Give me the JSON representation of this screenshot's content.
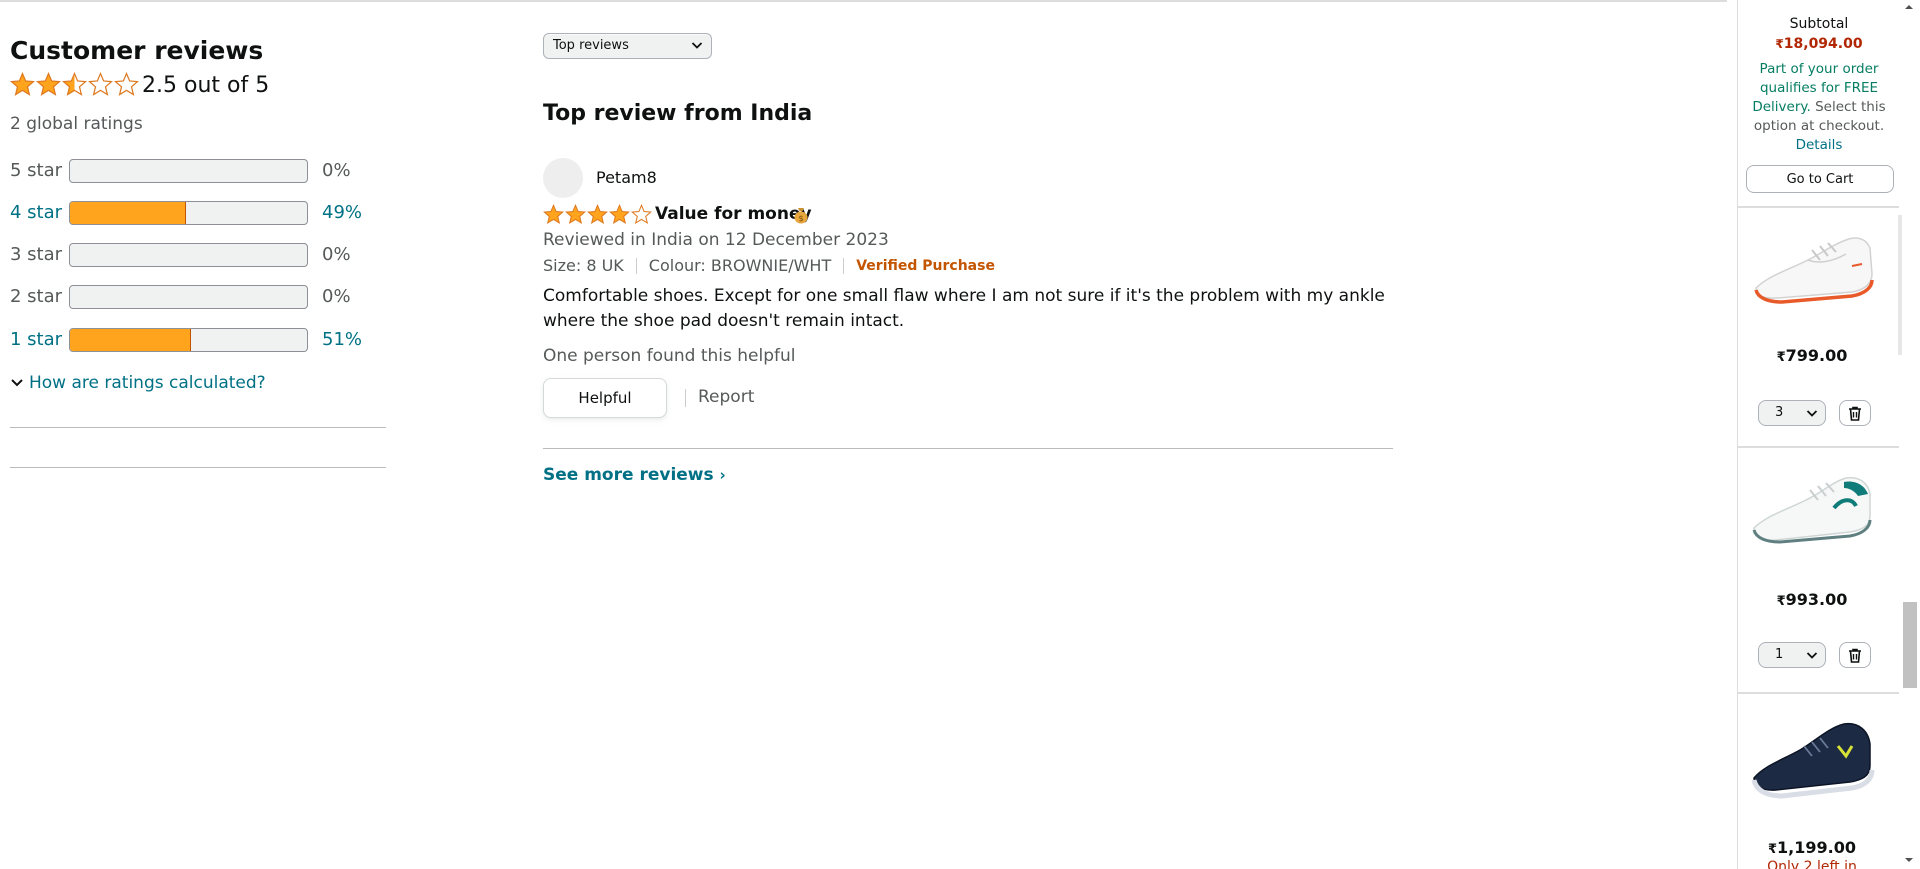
{
  "reviews_summary": {
    "heading": "Customer reviews",
    "average_rating": 2.5,
    "average_text": "2.5 out of 5",
    "global_ratings": "2 global ratings",
    "histogram": [
      {
        "label": "5 star",
        "percent_text": "0%",
        "percent": 0,
        "linked": false
      },
      {
        "label": "4 star",
        "percent_text": "49%",
        "percent": 49,
        "linked": true
      },
      {
        "label": "3 star",
        "percent_text": "0%",
        "percent": 0,
        "linked": false
      },
      {
        "label": "2 star",
        "percent_text": "0%",
        "percent": 0,
        "linked": false
      },
      {
        "label": "1 star",
        "percent_text": "51%",
        "percent": 51,
        "linked": true
      }
    ],
    "how_calculated": "How are ratings calculated?"
  },
  "review": {
    "sort_label": "Top reviews",
    "section_title": "Top review from India",
    "reviewer": "Petam8",
    "rating": 4,
    "headline": "Value for money",
    "date_text": "Reviewed in India on 12 December 2023",
    "size": "Size: 8 UK",
    "colour": "Colour: BROWNIE/WHT",
    "verified": "Verified Purchase",
    "body": "Comfortable shoes. Except for one small flaw where I am not sure if it's the problem with my ankle where the shoe pad doesn't remain intact.",
    "helpful_count_text": "One person found this helpful",
    "helpful_button": "Helpful",
    "report": "Report",
    "see_more": "See more reviews",
    "see_more_chevron": "›"
  },
  "cart": {
    "subtotal_label": "Subtotal",
    "currency": "₹",
    "subtotal_amount": "18,094.00",
    "free_delivery": "Part of your order qualifies for FREE Delivery.",
    "select_option": "Select this option at checkout.",
    "details": "Details",
    "go_to_cart": "Go to Cart",
    "items": [
      {
        "price": "799.00",
        "qty": "3",
        "image": "white-sneaker-orange-sole",
        "color": "#e85a2a"
      },
      {
        "price": "993.00",
        "qty": "1",
        "image": "white-sneaker-teal-accent",
        "color": "#0f7c7a"
      },
      {
        "price": "1,199.00",
        "low_stock": "Only 2 left in",
        "image": "navy-sneaker-yellow-logo",
        "color": "#1d2a44"
      }
    ]
  },
  "colors": {
    "star": "#ffa41c",
    "link": "#007185",
    "price_red": "#b12704",
    "verified": "#c45500",
    "free_green": "#067d62"
  }
}
